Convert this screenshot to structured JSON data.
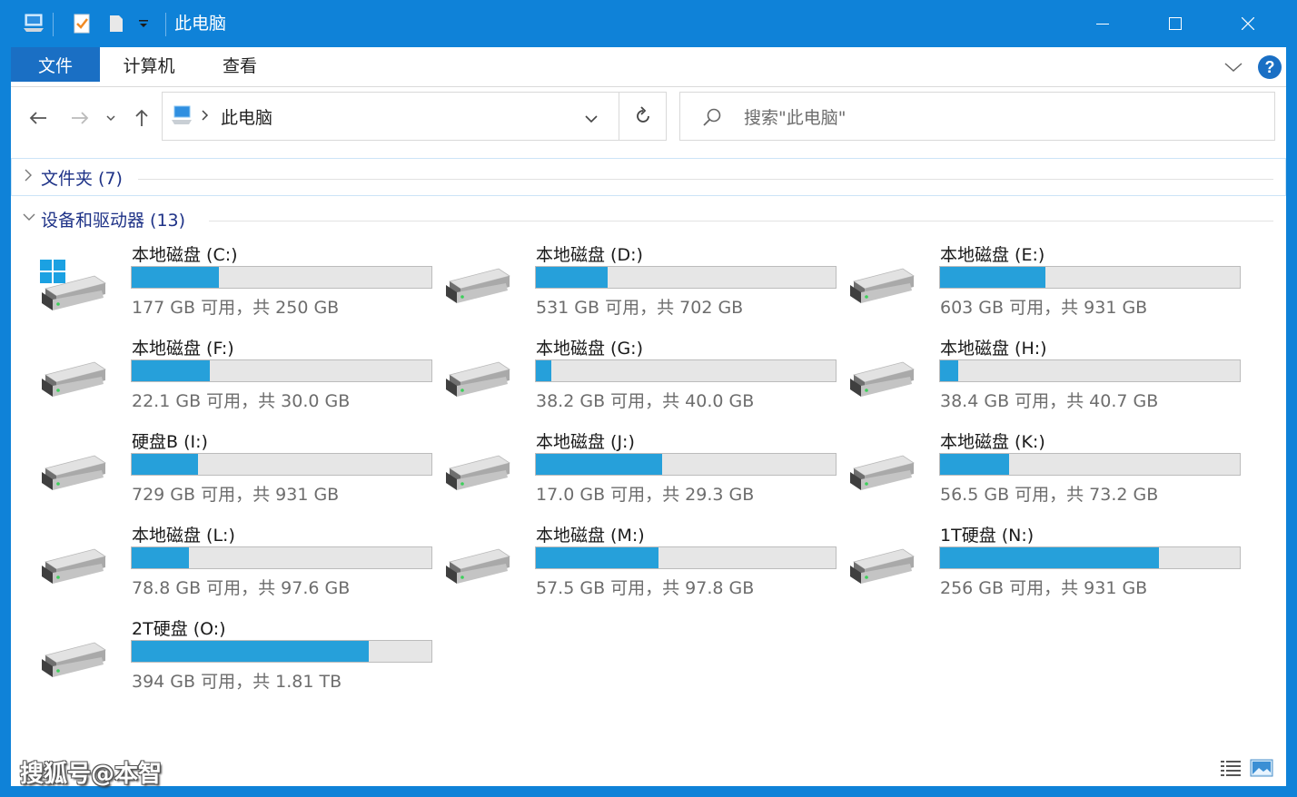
{
  "window": {
    "title": "此电脑",
    "accent_color": "#0f82d8",
    "quick_access": [
      "computer-icon",
      "properties-icon",
      "new-folder-icon",
      "customize-dropdown-icon"
    ],
    "controls": [
      "minimize-icon",
      "maximize-icon",
      "close-icon"
    ]
  },
  "ribbon": {
    "tabs": [
      {
        "label": "文件",
        "active": true
      },
      {
        "label": "计算机",
        "active": false
      },
      {
        "label": "查看",
        "active": false
      }
    ],
    "right_icons": [
      "expand-ribbon-icon",
      "help-icon"
    ]
  },
  "nav": {
    "buttons": [
      "back-arrow-icon",
      "forward-arrow-icon",
      "recent-dropdown-icon",
      "up-arrow-icon"
    ],
    "address": {
      "icon": "computer-icon",
      "path": "此电脑"
    },
    "search_placeholder": "搜索\"此电脑\""
  },
  "groups": {
    "folders": {
      "label": "文件夹 (7)",
      "expanded": false
    },
    "devices": {
      "label": "设备和驱动器 (13)",
      "expanded": true
    }
  },
  "drives": [
    {
      "name": "本地磁盘 (C:)",
      "info": "177 GB 可用，共 250 GB",
      "used_fraction": 0.29,
      "icon": "windows-drive-icon"
    },
    {
      "name": "本地磁盘 (D:)",
      "info": "531 GB 可用，共 702 GB",
      "used_fraction": 0.24,
      "icon": "hard-drive-icon"
    },
    {
      "name": "本地磁盘 (E:)",
      "info": "603 GB 可用，共 931 GB",
      "used_fraction": 0.35,
      "icon": "hard-drive-icon"
    },
    {
      "name": "本地磁盘 (F:)",
      "info": "22.1 GB 可用，共 30.0 GB",
      "used_fraction": 0.26,
      "icon": "hard-drive-icon"
    },
    {
      "name": "本地磁盘 (G:)",
      "info": "38.2 GB 可用，共 40.0 GB",
      "used_fraction": 0.05,
      "icon": "hard-drive-icon"
    },
    {
      "name": "本地磁盘 (H:)",
      "info": "38.4 GB 可用，共 40.7 GB",
      "used_fraction": 0.06,
      "icon": "hard-drive-icon"
    },
    {
      "name": "硬盘B (I:)",
      "info": "729 GB 可用，共 931 GB",
      "used_fraction": 0.22,
      "icon": "hard-drive-icon"
    },
    {
      "name": "本地磁盘 (J:)",
      "info": "17.0 GB 可用，共 29.3 GB",
      "used_fraction": 0.42,
      "icon": "hard-drive-icon"
    },
    {
      "name": "本地磁盘 (K:)",
      "info": "56.5 GB 可用，共 73.2 GB",
      "used_fraction": 0.23,
      "icon": "hard-drive-icon"
    },
    {
      "name": "本地磁盘 (L:)",
      "info": "78.8 GB 可用，共 97.6 GB",
      "used_fraction": 0.19,
      "icon": "hard-drive-icon"
    },
    {
      "name": "本地磁盘 (M:)",
      "info": "57.5 GB 可用，共 97.8 GB",
      "used_fraction": 0.41,
      "icon": "hard-drive-icon"
    },
    {
      "name": "1T硬盘 (N:)",
      "info": "256 GB 可用，共 931 GB",
      "used_fraction": 0.73,
      "icon": "hard-drive-icon"
    },
    {
      "name": "2T硬盘 (O:)",
      "info": "394 GB 可用，共 1.81 TB",
      "used_fraction": 0.79,
      "icon": "hard-drive-icon"
    }
  ],
  "status": {
    "watermark": "搜狐号@本智",
    "view_buttons": [
      "details-view-icon",
      "large-icons-view-icon"
    ]
  }
}
